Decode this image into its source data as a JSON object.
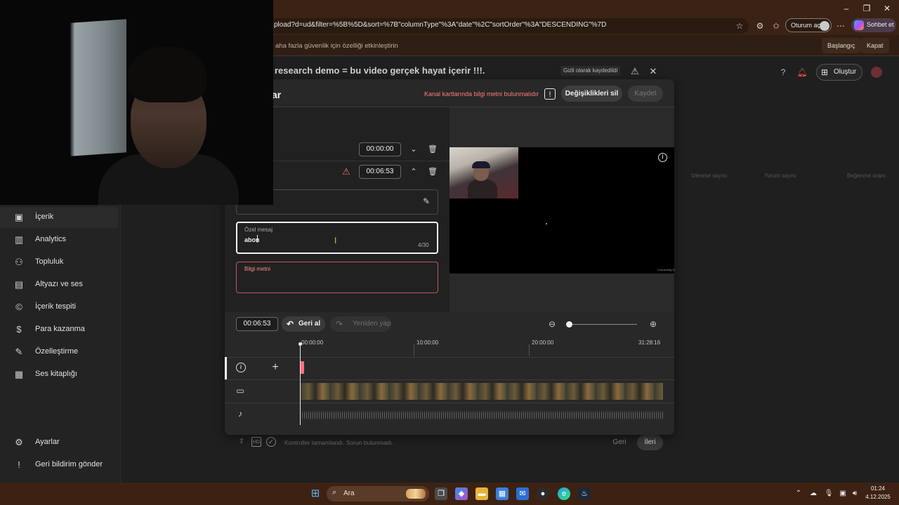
{
  "browser": {
    "url": "pload?d=ud&filter=%5B%5D&sort=%7B\"columnType\"%3A\"date\"%2C\"sortOrder\"%3A\"DESCENDING\"%7D",
    "signin_label": "Oturum aç",
    "copilot_label": "Sohbet et",
    "window_controls": [
      "–",
      "❐",
      "✕"
    ],
    "infobar_text": "aha fazla güvenlik için özelliği etkinleştirin",
    "infobar_buttons": {
      "start": "Başlangıç",
      "close": "Kapat"
    }
  },
  "studio": {
    "sidebar": [
      {
        "label": "İçerik",
        "icon": "content-icon",
        "glyph": "▣",
        "active": true
      },
      {
        "label": "Analytics",
        "icon": "analytics-icon",
        "glyph": "▥",
        "active": false
      },
      {
        "label": "Topluluk",
        "icon": "community-icon",
        "glyph": "⚇",
        "active": false
      },
      {
        "label": "Altyazı ve ses",
        "icon": "subtitles-icon",
        "glyph": "▤",
        "active": false
      },
      {
        "label": "İçerik tespiti",
        "icon": "copyright-icon",
        "glyph": "©",
        "active": false
      },
      {
        "label": "Para kazanma",
        "icon": "monetization-icon",
        "glyph": "$",
        "active": false
      },
      {
        "label": "Özelleştirme",
        "icon": "customization-icon",
        "glyph": "✎",
        "active": false
      },
      {
        "label": "Ses kitaplığı",
        "icon": "audio-library-icon",
        "glyph": "▦",
        "active": false
      }
    ],
    "sidebar_bottom": [
      {
        "label": "Ayarlar",
        "icon": "settings-icon",
        "glyph": "⚙"
      },
      {
        "label": "Geri bildirim gönder",
        "icon": "feedback-icon",
        "glyph": "!"
      }
    ],
    "create_label": "Oluştur",
    "column_headers": [
      "İzlenme sayısı",
      "Yorum sayısı",
      "Beğenme oranı"
    ]
  },
  "upload_dialog": {
    "title": "research demo = bu video gerçek hayat içerir !!!.",
    "saved_status": "Gizli olarak kaydedildi",
    "checks_text": "Kontroller tamamlandı. Sorun bulunmadı.",
    "hd_badge": "HD",
    "back_label": "Geri",
    "next_label": "İleri"
  },
  "editor": {
    "title": "ar",
    "warning": "Kanal kartlarında bilgi metni bulunmalıdır",
    "discard_label": "Değişiklikleri sil",
    "save_label": "Kaydet",
    "elements": [
      {
        "time": "00:00:00",
        "expanded": false,
        "warning": false
      },
      {
        "time": "00:06:53",
        "expanded": true,
        "warning": true
      }
    ],
    "custom_message": {
      "label": "Özel mesaj",
      "value": "abon",
      "counter": "4/30"
    },
    "info_text": {
      "label": "Bilgi metni",
      "value": ""
    },
    "preview_watermark": "Connecting ◎"
  },
  "timeline": {
    "current_time": "00:06:53",
    "undo_label": "Geri al",
    "redo_label": "Yeniden yap",
    "ticks": [
      "00:00:00",
      "10:00:00",
      "20:00:00",
      "31:28:16"
    ],
    "zoom_level": 0
  },
  "taskbar": {
    "search_label": "Ara",
    "time": "01:24",
    "date": "4.12.2025"
  }
}
